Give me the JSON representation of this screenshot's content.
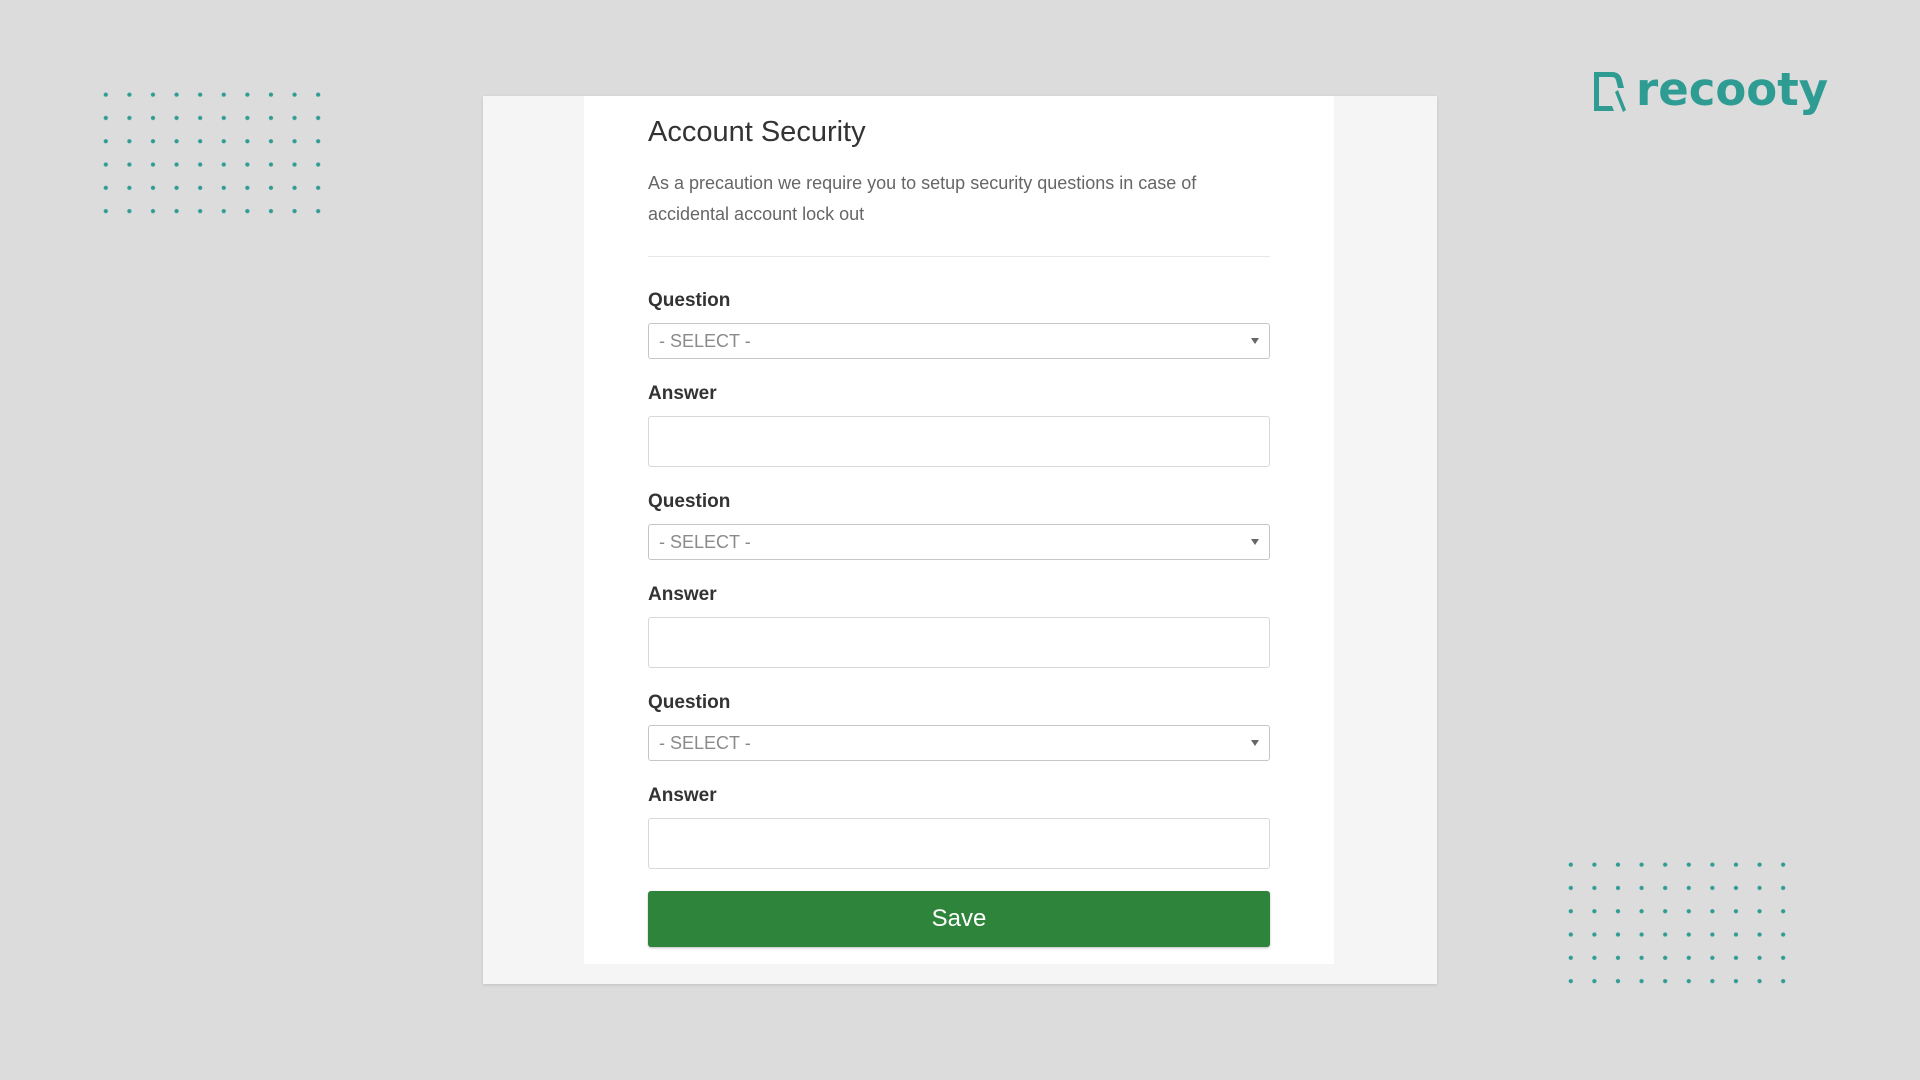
{
  "brand": {
    "logo_text": "recooty",
    "logo_icon": "document-icon",
    "accent_color": "#2f9c94"
  },
  "form": {
    "title": "Account Security",
    "description": "As a precaution we require you to setup security questions in case of accidental account lock out",
    "question_label": "Question",
    "answer_label": "Answer",
    "select_placeholder": "- SELECT -",
    "questions": [
      {
        "label": "Question",
        "selected": "- SELECT -",
        "answer_label": "Answer",
        "answer_value": ""
      },
      {
        "label": "Question",
        "selected": "- SELECT -",
        "answer_label": "Answer",
        "answer_value": ""
      },
      {
        "label": "Question",
        "selected": "- SELECT -",
        "answer_label": "Answer",
        "answer_value": ""
      }
    ],
    "save_label": "Save",
    "save_color": "#2e843a"
  }
}
